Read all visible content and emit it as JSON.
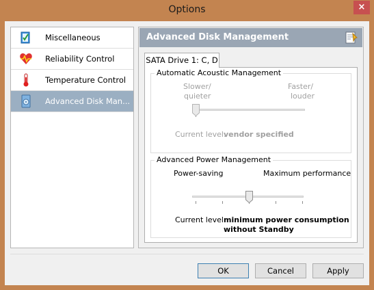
{
  "window": {
    "title": "Options",
    "close_glyph": "×"
  },
  "sidebar": {
    "items": [
      {
        "label": "Miscellaneous",
        "icon": "miscellaneous-icon"
      },
      {
        "label": "Reliability Control",
        "icon": "heart-pulse-icon"
      },
      {
        "label": "Temperature Control",
        "icon": "thermometer-icon"
      },
      {
        "label": "Advanced Disk Man...",
        "icon": "disk-icon"
      }
    ],
    "selected_index": 3
  },
  "panel": {
    "title": "Advanced Disk Management",
    "tab_label": "SATA Drive 1: C, D",
    "aam": {
      "title": "Automatic Acoustic Management",
      "left_label_1": "Slower/",
      "left_label_2": "quieter",
      "right_label_1": "Faster/",
      "right_label_2": "louder",
      "current_level_label": "Current level:",
      "current_level_value": "vendor specified",
      "slider_position": 0,
      "enabled": false
    },
    "apm": {
      "title": "Advanced Power Management",
      "left_label": "Power-saving",
      "right_label": "Maximum performance",
      "current_level_label": "Current level:",
      "current_level_value_1": "minimum power consumption",
      "current_level_value_2": "without Standby",
      "slider_position": 0.5,
      "enabled": true
    }
  },
  "buttons": {
    "ok": "OK",
    "cancel": "Cancel",
    "apply": "Apply"
  },
  "colors": {
    "title_bar": "#c38450",
    "selected_item": "#9bafc2",
    "panel_header": "#9aa6b4",
    "close_button": "#c75050"
  }
}
